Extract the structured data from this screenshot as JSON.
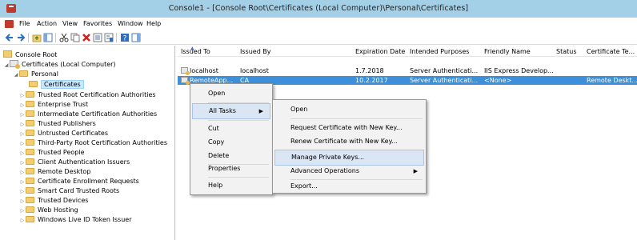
{
  "window": {
    "title": "Console1 - [Console Root\\Certificates (Local Computer)\\Personal\\Certificates]"
  },
  "menubar": {
    "items": [
      "File",
      "Action",
      "View",
      "Favorites",
      "Window",
      "Help"
    ]
  },
  "toolbar": {
    "buttons": [
      "back-arrow-icon",
      "forward-arrow-icon",
      "up-folder-icon",
      "show-hide-tree-icon",
      "cut-icon",
      "copy-icon",
      "delete-icon",
      "export-list-icon",
      "properties-icon",
      "help-icon",
      "show-action-pane-icon"
    ]
  },
  "tree": {
    "items": [
      {
        "label": "Console Root",
        "level": 0,
        "icon": "console-root-icon",
        "expander": ""
      },
      {
        "label": "Certificates (Local Computer)",
        "level": 1,
        "icon": "certificate-store-icon",
        "expander": "◢"
      },
      {
        "label": "Personal",
        "level": 2,
        "icon": "folder-icon",
        "expander": "◢"
      },
      {
        "label": "Certificates",
        "level": 3,
        "icon": "folder-icon",
        "expander": "",
        "selected": true
      },
      {
        "label": "Trusted Root Certification Authorities",
        "level": 2,
        "icon": "folder-icon",
        "expander": "▷"
      },
      {
        "label": "Enterprise Trust",
        "level": 2,
        "icon": "folder-icon",
        "expander": "▷"
      },
      {
        "label": "Intermediate Certification Authorities",
        "level": 2,
        "icon": "folder-icon",
        "expander": "▷"
      },
      {
        "label": "Trusted Publishers",
        "level": 2,
        "icon": "folder-icon",
        "expander": "▷"
      },
      {
        "label": "Untrusted Certificates",
        "level": 2,
        "icon": "folder-icon",
        "expander": "▷"
      },
      {
        "label": "Third-Party Root Certification Authorities",
        "level": 2,
        "icon": "folder-icon",
        "expander": "▷"
      },
      {
        "label": "Trusted People",
        "level": 2,
        "icon": "folder-icon",
        "expander": "▷"
      },
      {
        "label": "Client Authentication Issuers",
        "level": 2,
        "icon": "folder-icon",
        "expander": "▷"
      },
      {
        "label": "Remote Desktop",
        "level": 2,
        "icon": "folder-icon",
        "expander": "▷"
      },
      {
        "label": "Certificate Enrollment Requests",
        "level": 2,
        "icon": "folder-icon",
        "expander": "▷"
      },
      {
        "label": "Smart Card Trusted Roots",
        "level": 2,
        "icon": "folder-icon",
        "expander": "▷"
      },
      {
        "label": "Trusted Devices",
        "level": 2,
        "icon": "folder-icon",
        "expander": "▷"
      },
      {
        "label": "Web Hosting",
        "level": 2,
        "icon": "folder-icon",
        "expander": "▷"
      },
      {
        "label": "Windows Live ID Token Issuer",
        "level": 2,
        "icon": "folder-icon",
        "expander": "▷"
      }
    ]
  },
  "list": {
    "columns": [
      "Issued To",
      "Issued By",
      "Expiration Date",
      "Intended Purposes",
      "Friendly Name",
      "Status",
      "Certificate Te..."
    ],
    "rows": [
      {
        "issued_to": "localhost",
        "issued_by": "localhost",
        "expiration": "1.7.2018",
        "purposes": "Server Authenticati...",
        "friendly": "IIS Express Develop...",
        "status": "",
        "template": "",
        "selected": false
      },
      {
        "issued_to": "RemoteApp...",
        "issued_by": "CA",
        "expiration": "10.2.2017",
        "purposes": "Server Authenticati...",
        "friendly": "<None>",
        "status": "",
        "template": "Remote Deskt...",
        "selected": true
      }
    ]
  },
  "context_menu": {
    "items": [
      "Open",
      "All Tasks",
      "Cut",
      "Copy",
      "Delete",
      "Properties",
      "Help"
    ],
    "highlighted": "All Tasks"
  },
  "submenu": {
    "items": [
      "Open",
      "Request Certificate with New Key...",
      "Renew Certificate with New Key...",
      "Manage Private Keys...",
      "Advanced Operations",
      "Export..."
    ],
    "highlighted": "Manage Private Keys..."
  },
  "colors": {
    "titlebar": "#a3cfe7",
    "selection": "#3c8fd8",
    "menu_highlight": "#dbe6f4",
    "folder": "#f2cd72"
  }
}
